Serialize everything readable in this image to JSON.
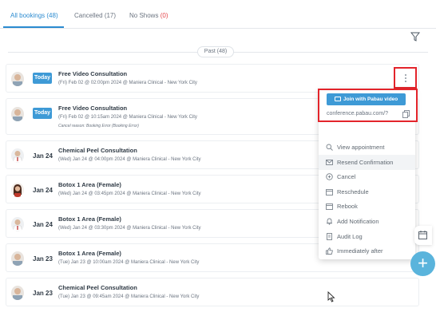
{
  "tabs": [
    {
      "label": "All bookings",
      "count": "(48)"
    },
    {
      "label": "Cancelled",
      "count": "(17)"
    },
    {
      "label": "No Shows",
      "count": "(0)"
    }
  ],
  "past_divider": "Past (48)",
  "bookings": [
    {
      "date": "Today",
      "title": "Free Video Consultation",
      "subtitle": "(Fri) Feb 02 @ 02:00pm 2024 @ Maniera Clinical - New York City",
      "note": ""
    },
    {
      "date": "Today",
      "title": "Free Video Consultation",
      "subtitle": "(Fri) Feb 02 @ 10:15am 2024 @ Maniera Clinical - New York City",
      "note": "Cancel reason: Booking Error (Booking Error)"
    },
    {
      "date": "Jan 24",
      "title": "Chemical Peel Consultation",
      "subtitle": "(Wed) Jan 24 @ 04:00pm 2024 @ Maniera Clinical - New York City",
      "note": ""
    },
    {
      "date": "Jan 24",
      "title": "Botox 1 Area (Female)",
      "subtitle": "(Wed) Jan 24 @ 03:45pm 2024 @ Maniera Clinical - New York City",
      "note": ""
    },
    {
      "date": "Jan 24",
      "title": "Botox 1 Area (Female)",
      "subtitle": "(Wed) Jan 24 @ 03:30pm 2024 @ Maniera Clinical - New York City",
      "note": ""
    },
    {
      "date": "Jan 23",
      "title": "Botox 1 Area (Female)",
      "subtitle": "(Tue) Jan 23 @ 10:00am 2024 @ Maniera Clinical - New York City",
      "note": ""
    },
    {
      "date": "Jan 23",
      "title": "Chemical Peel Consultation",
      "subtitle": "(Tue) Jan 23 @ 09:45am 2024 @ Maniera Clinical - New York City",
      "note": ""
    }
  ],
  "dropdown": {
    "join_label": "Join with Pabau video",
    "conference_link": "conference.pabau.com/?",
    "items": [
      {
        "label": "View appointment",
        "icon": "search-icon"
      },
      {
        "label": "Resend Confirmation",
        "icon": "envelope-icon"
      },
      {
        "label": "Cancel",
        "icon": "cancel-circle-icon"
      },
      {
        "label": "Reschedule",
        "icon": "calendar-icon"
      },
      {
        "label": "Rebook",
        "icon": "calendar-icon"
      },
      {
        "label": "Add Notification",
        "icon": "bell-icon"
      },
      {
        "label": "Audit Log",
        "icon": "document-icon"
      },
      {
        "label": "Immediately after",
        "icon": "thumbs-up-icon"
      }
    ]
  },
  "fab_label": "+",
  "colors": {
    "accent": "#3e9ad6",
    "highlight": "#e3242b",
    "fab": "#5ab4dc",
    "no_show_count": "#e5484d"
  }
}
